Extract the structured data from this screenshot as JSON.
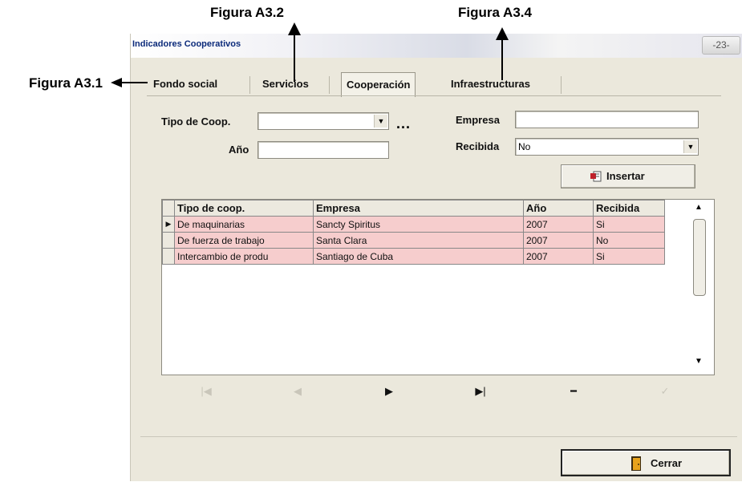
{
  "annotations": {
    "fig_a32": "Figura A3.2",
    "fig_a34": "Figura A3.4",
    "fig_a31": "Figura A3.1"
  },
  "window": {
    "title": "Indicadores Cooperativos",
    "close_label": "-23-"
  },
  "tabs": [
    {
      "label": "Fondo social",
      "active": false
    },
    {
      "label": "Servicios",
      "active": false
    },
    {
      "label": "Cooperación",
      "active": true
    },
    {
      "label": "Infraestructuras",
      "active": false
    }
  ],
  "form": {
    "tipo_label": "Tipo de Coop.",
    "tipo_value": "",
    "anio_label": "Año",
    "anio_value": "",
    "dots_label": "...",
    "empresa_label": "Empresa",
    "empresa_value": "",
    "recibida_label": "Recibida",
    "recibida_value": "No",
    "insertar_label": "Insertar"
  },
  "table": {
    "columns": [
      "Tipo de coop.",
      "Empresa",
      "Año",
      "Recibida"
    ],
    "rows": [
      {
        "tipo": "De maquinarias",
        "empresa": "Sancty Spiritus",
        "anio": "2007",
        "recibida": "Si"
      },
      {
        "tipo": "De fuerza de trabajo",
        "empresa": "Santa Clara",
        "anio": "2007",
        "recibida": "No"
      },
      {
        "tipo": "Intercambio de produ",
        "empresa": "Santiago de Cuba",
        "anio": "2007",
        "recibida": "Si"
      }
    ]
  },
  "navigator": {
    "first": "|◀",
    "prev": "◀",
    "next": "▶",
    "last": "▶|",
    "delete": "━",
    "post": "✓"
  },
  "footer": {
    "cerrar_label": "Cerrar"
  },
  "colors": {
    "row_highlight": "#f6cdcd",
    "window_bg": "#ebe8dc"
  }
}
